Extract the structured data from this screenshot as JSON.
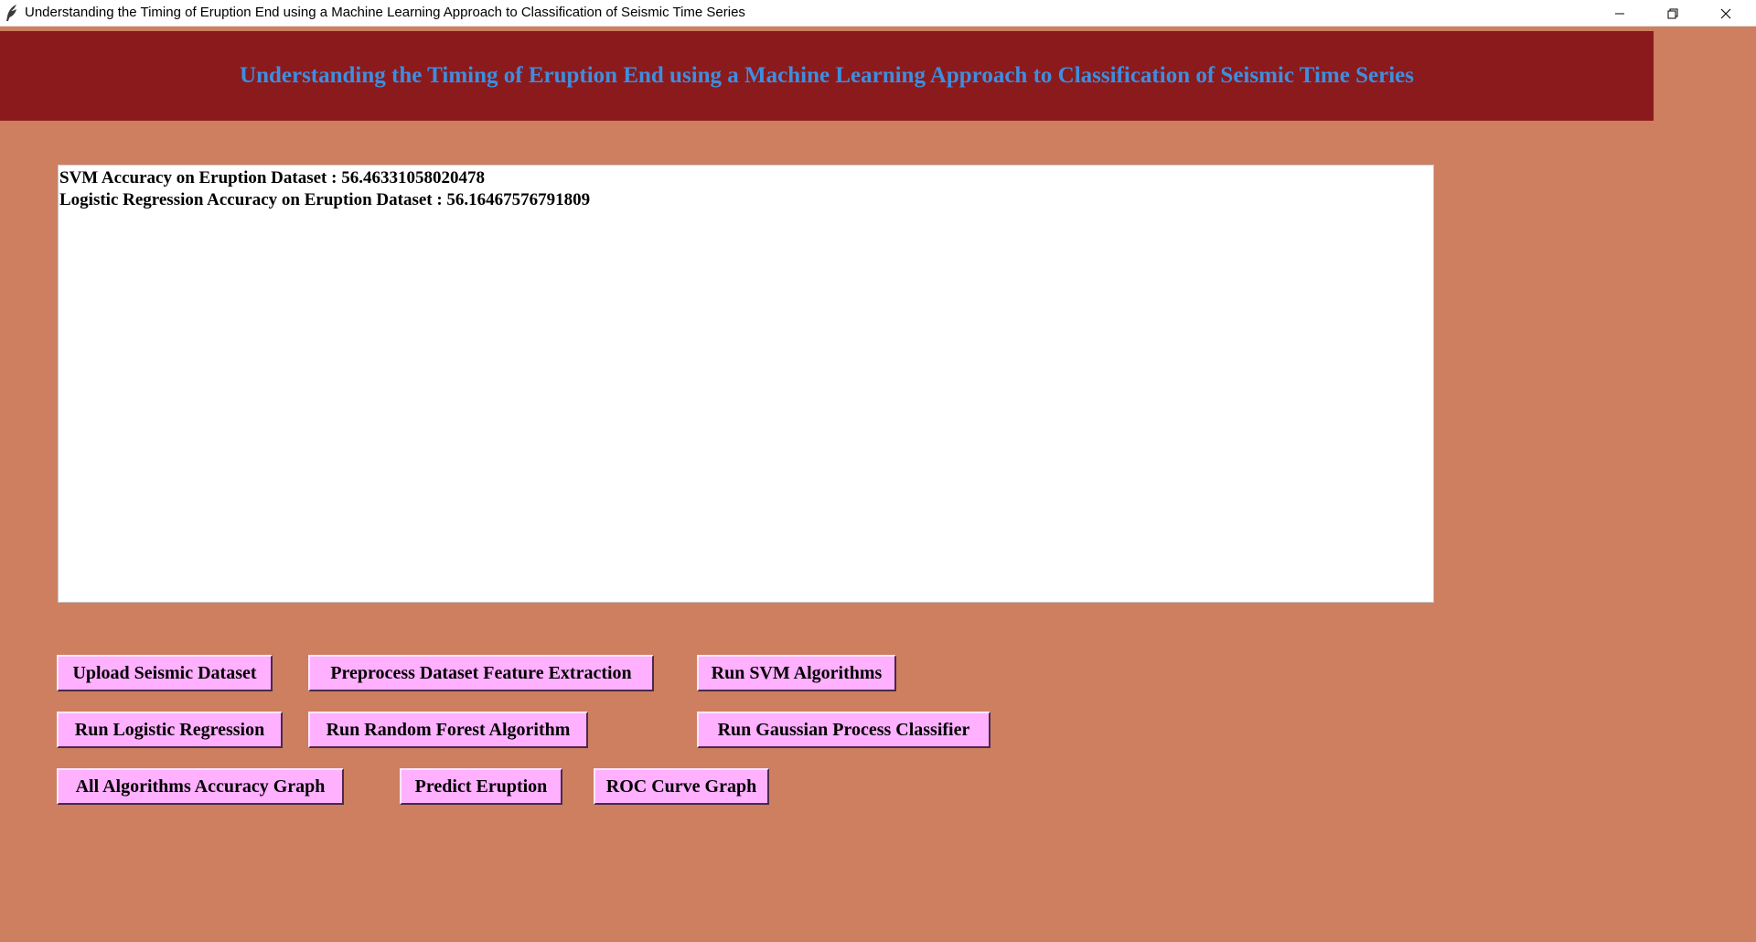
{
  "window": {
    "title": "Understanding the Timing of Eruption End using a Machine Learning Approach to Classification of Seismic Time Series",
    "icon": "feather-icon",
    "controls": [
      "minimize-icon",
      "restore-icon",
      "close-icon"
    ]
  },
  "header": {
    "title": "Understanding the Timing of Eruption End using a Machine Learning Approach to Classification of Seismic Time Series"
  },
  "output": {
    "lines": [
      "SVM Accuracy on Eruption Dataset : 56.46331058020478",
      "Logistic Regression Accuracy on Eruption Dataset : 56.16467576791809"
    ]
  },
  "buttons": {
    "upload": "Upload Seismic Dataset",
    "preprocess": "Preprocess Dataset Feature Extraction",
    "svm": "Run SVM Algorithms",
    "logistic": "Run Logistic Regression",
    "random_forest": "Run Random Forest Algorithm",
    "gaussian": "Run Gaussian Process Classifier",
    "accuracy_graph": "All Algorithms Accuracy Graph",
    "predict": "Predict Eruption",
    "roc": "ROC Curve Graph"
  },
  "colors": {
    "background": "#cd7f60",
    "banner": "#8b1a1c",
    "banner_text": "#3d8ee0",
    "button": "#ffb0ff"
  }
}
